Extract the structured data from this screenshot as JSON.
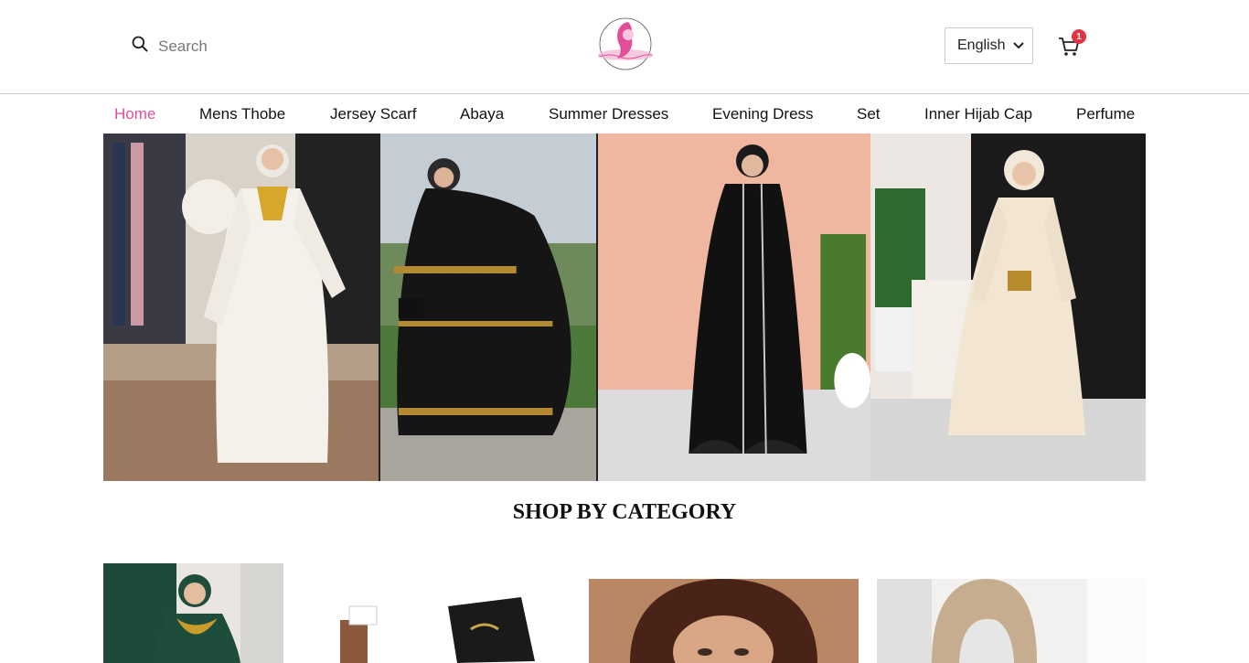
{
  "header": {
    "search_placeholder": "Search",
    "language": "English",
    "cart_count": "1"
  },
  "nav": {
    "items": [
      {
        "label": "Home",
        "active": true
      },
      {
        "label": "Mens Thobe"
      },
      {
        "label": "Jersey Scarf"
      },
      {
        "label": "Abaya"
      },
      {
        "label": "Summer Dresses"
      },
      {
        "label": "Evening Dress"
      },
      {
        "label": "Set"
      },
      {
        "label": "Inner Hijab Cap"
      },
      {
        "label": "Perfume"
      }
    ]
  },
  "main": {
    "section_title": "SHOP BY CATEGORY"
  },
  "colors": {
    "accent": "#e14f98",
    "badge": "#e0343f"
  }
}
